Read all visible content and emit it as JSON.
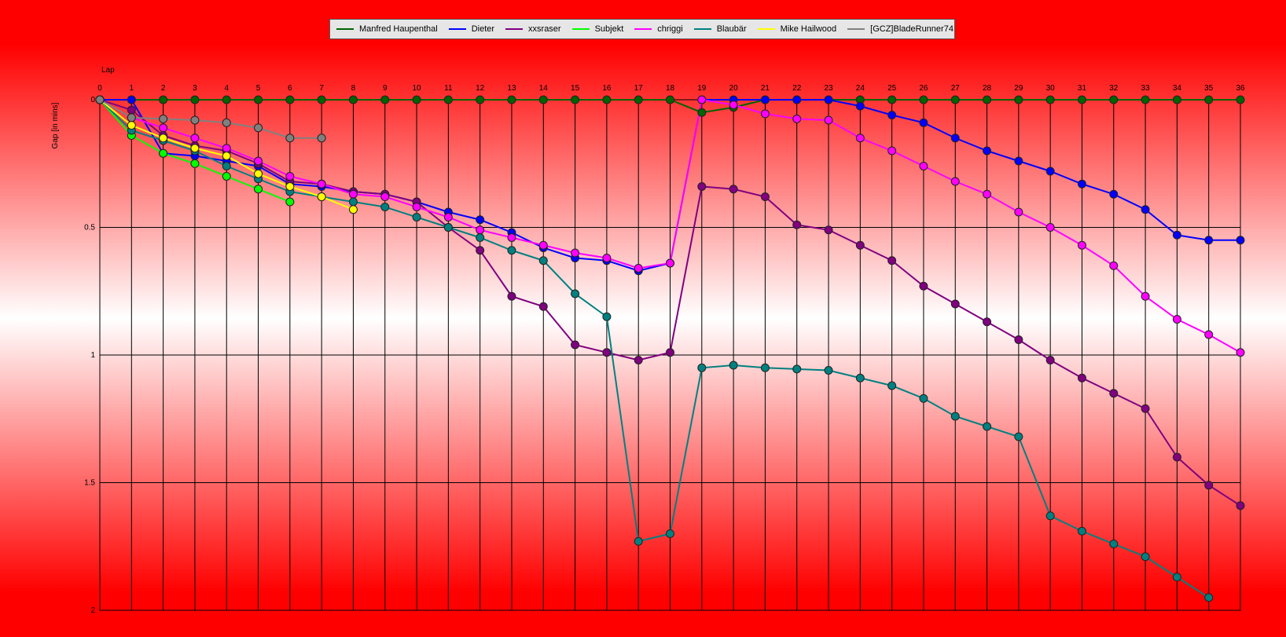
{
  "chart_data": {
    "type": "line",
    "title": "",
    "xlabel": "Lap",
    "ylabel": "Gap [in mins]",
    "x": [
      0,
      1,
      2,
      3,
      4,
      5,
      6,
      7,
      8,
      9,
      10,
      11,
      12,
      13,
      14,
      15,
      16,
      17,
      18,
      19,
      20,
      21,
      22,
      23,
      24,
      25,
      26,
      27,
      28,
      29,
      30,
      31,
      32,
      33,
      34,
      35,
      36
    ],
    "xlim": [
      0,
      36
    ],
    "ylim": [
      0,
      2
    ],
    "y_inverted": true,
    "yticks": [
      "0",
      "0.5",
      "1",
      "1.5",
      "2"
    ],
    "grid": true,
    "legend_position": "top-center",
    "series": [
      {
        "name": "Manfred Haupenthal",
        "color": "#006400",
        "values": [
          0,
          0,
          0,
          0,
          0,
          0,
          0,
          0,
          0,
          0,
          0,
          0,
          0,
          0,
          0,
          0,
          0,
          0,
          0,
          0.05,
          0.03,
          0,
          0,
          0,
          0,
          0,
          0,
          0,
          0,
          0,
          0,
          0,
          0,
          0,
          0,
          0,
          0
        ]
      },
      {
        "name": "Dieter",
        "color": "#0000ff",
        "values": [
          0,
          0,
          0.21,
          0.22,
          0.24,
          0.26,
          0.33,
          0.34,
          0.36,
          0.37,
          0.4,
          0.44,
          0.47,
          0.52,
          0.58,
          0.62,
          0.63,
          0.67,
          0.64,
          0,
          0,
          0,
          0,
          0,
          0.025,
          0.06,
          0.09,
          0.15,
          0.2,
          0.24,
          0.28,
          0.33,
          0.37,
          0.43,
          0.53,
          0.55,
          0.55
        ]
      },
      {
        "name": "xxsraser",
        "color": "#800080",
        "values": [
          0,
          0.04,
          0.14,
          0.18,
          0.2,
          0.25,
          0.32,
          0.33,
          0.36,
          0.37,
          0.4,
          0.5,
          0.59,
          0.77,
          0.81,
          0.96,
          0.99,
          1.02,
          0.99,
          0.34,
          0.35,
          0.38,
          0.49,
          0.51,
          0.57,
          0.63,
          0.73,
          0.8,
          0.87,
          0.94,
          1.02,
          1.09,
          1.15,
          1.21,
          1.4,
          1.51,
          1.59
        ]
      },
      {
        "name": "Subjekt",
        "color": "#00ff00",
        "values": [
          0,
          0.14,
          0.21,
          0.25,
          0.3,
          0.35,
          0.4
        ]
      },
      {
        "name": "chriggi",
        "color": "#ff00ff",
        "values": [
          0,
          0.07,
          0.11,
          0.15,
          0.19,
          0.24,
          0.3,
          0.33,
          0.37,
          0.38,
          0.42,
          0.46,
          0.51,
          0.54,
          0.57,
          0.6,
          0.62,
          0.66,
          0.64,
          0,
          0.02,
          0.055,
          0.075,
          0.08,
          0.15,
          0.2,
          0.26,
          0.32,
          0.37,
          0.44,
          0.5,
          0.57,
          0.65,
          0.77,
          0.86,
          0.92,
          0.99
        ]
      },
      {
        "name": "Blaubär",
        "color": "#008080",
        "values": [
          0,
          0.12,
          0.16,
          0.2,
          0.26,
          0.31,
          0.36,
          0.38,
          0.4,
          0.42,
          0.46,
          0.5,
          0.54,
          0.59,
          0.63,
          0.76,
          0.85,
          1.73,
          1.7,
          1.05,
          1.04,
          1.05,
          1.055,
          1.06,
          1.09,
          1.12,
          1.17,
          1.24,
          1.28,
          1.32,
          1.63,
          1.69,
          1.74,
          1.79,
          1.87,
          1.95
        ]
      },
      {
        "name": "Mike Hailwood",
        "color": "#ffff00",
        "values": [
          0,
          0.1,
          0.15,
          0.19,
          0.22,
          0.29,
          0.34,
          0.38,
          0.43
        ]
      },
      {
        "name": "[GCZ]BladeRunner74",
        "color": "#808080",
        "values": [
          0,
          0.07,
          0.075,
          0.08,
          0.09,
          0.11,
          0.15,
          0.15
        ]
      }
    ]
  }
}
